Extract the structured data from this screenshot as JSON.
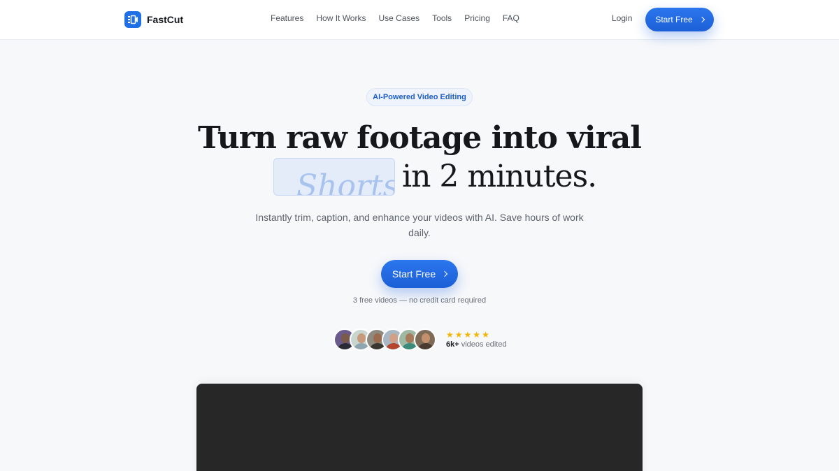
{
  "header": {
    "brand": "FastCut",
    "nav": [
      "Features",
      "How It Works",
      "Use Cases",
      "Tools",
      "Pricing",
      "FAQ"
    ],
    "login": "Login",
    "cta": "Start Free"
  },
  "hero": {
    "badge": "AI-Powered Video Editing",
    "headline_line1": "Turn raw footage into viral",
    "rotating_word": "Shorts",
    "headline_line2_suffix": "in 2 minutes.",
    "subtitle": "Instantly trim, caption, and enhance your videos with AI. Save hours of work daily.",
    "cta": "Start Free",
    "note": "3 free videos — no credit card required"
  },
  "social_proof": {
    "rating_stars": 5,
    "count": "6k+",
    "count_label": "videos edited",
    "avatar_count": 6
  },
  "colors": {
    "accent": "#1f6fe5",
    "background": "#f7f8fa",
    "star": "#f4b400",
    "video_frame": "#272727"
  },
  "icons": {
    "brand": "video-cut-icon",
    "cta": "chevron-right-icon",
    "star": "star-icon"
  }
}
